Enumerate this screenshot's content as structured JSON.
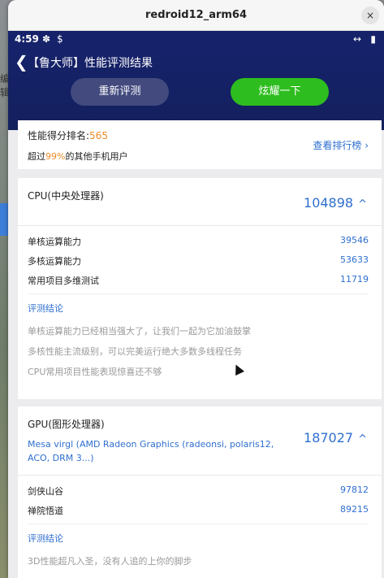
{
  "window": {
    "title": "redroid12_arm64",
    "close_glyph": "×"
  },
  "desktop": {
    "label": "编辑"
  },
  "statusbar": {
    "time": "4:59",
    "icon1": "✽",
    "icon2": "$",
    "right1": "↔",
    "right2": "▮"
  },
  "appbar": {
    "back_glyph": "❮",
    "title": "【鲁大师】性能评测结果",
    "redo_label": "重新评测",
    "show_label": "炫耀一下"
  },
  "rank": {
    "prefix": "性能得分排名:",
    "rank_value": "565",
    "beat_prefix": "超过",
    "beat_pct": "99%",
    "beat_suffix": "的其他手机用户",
    "link_label": "查看排行榜",
    "link_glyph": "›"
  },
  "cpu": {
    "title": "CPU(中央处理器)",
    "score": "104898",
    "chevron": "^",
    "rows": [
      {
        "label": "单核运算能力",
        "value": "39546"
      },
      {
        "label": "多核运算能力",
        "value": "53633"
      },
      {
        "label": "常用项目多维测试",
        "value": "11719"
      }
    ],
    "conclusion_title": "评测结论",
    "conclusions": [
      "单核运算能力已经相当强大了，让我们一起为它加油鼓掌",
      "多核性能主流级别，可以完美运行绝大多数多线程任务",
      "CPU常用项目性能表现惊喜还不够"
    ]
  },
  "gpu": {
    "title": "GPU(图形处理器)",
    "model": "Mesa virgl (AMD Radeon Graphics (radeonsi, polaris12, ACO, DRM 3...)",
    "score": "187027",
    "chevron": "^",
    "rows": [
      {
        "label": "剑侠山谷",
        "value": "97812"
      },
      {
        "label": "禅院悟道",
        "value": "89215"
      }
    ],
    "conclusion_title": "评测结论",
    "conclusions": [
      "3D性能超凡入圣，没有人追的上你的脚步"
    ]
  },
  "colors": {
    "navy": "#16226a",
    "accent_blue": "#2e6fcf",
    "orange": "#ef8a27",
    "green": "#2ebd1e"
  }
}
